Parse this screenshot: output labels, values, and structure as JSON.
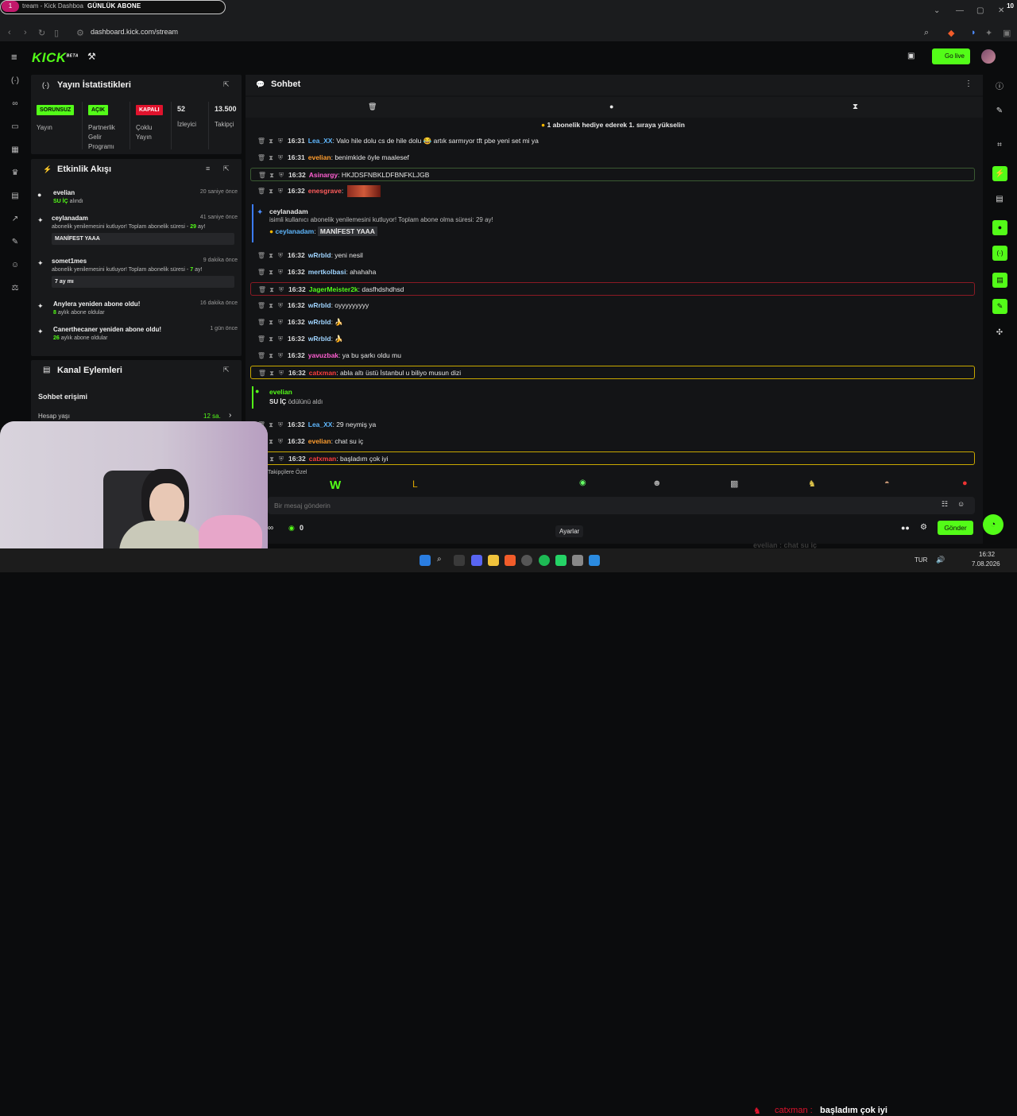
{
  "browser": {
    "tab_counter": "1",
    "tab_title": "tream - Kick Dashboa",
    "overlay_text": "GÜNLÜK ABONE",
    "overlay_count": "10",
    "url": "dashboard.kick.com/stream"
  },
  "header": {
    "logo": "KICK",
    "logo_tag": "BETA",
    "go_live": "Go live"
  },
  "stats_panel": {
    "title": "Yayın İstatistikleri",
    "items": [
      {
        "badge": "SORUNSUZ",
        "badge_color": "#53fc18",
        "label": "Yayın"
      },
      {
        "badge": "AÇIK",
        "badge_color": "#53fc18",
        "label": "Partnerlik Gelir Programı"
      },
      {
        "badge": "KAPALI",
        "badge_color": "#e0132d",
        "label": "Çoklu Yayın"
      },
      {
        "value": "52",
        "label": "İzleyici"
      },
      {
        "value": "13.500",
        "label": "Takipçi"
      }
    ]
  },
  "activity_panel": {
    "title": "Etkinlik Akışı",
    "items": [
      {
        "name": "evelian",
        "time": "20 saniye önce",
        "sub_highlight": "SU İÇ",
        "sub": "alındı"
      },
      {
        "name": "ceylanadam",
        "time": "41 saniye önce",
        "sub": "abonelik yenilemesini kutluyor! Toplam abonelik süresi -",
        "months": "29",
        "sub_end": "ay!",
        "box": "MANİFEST YAAA"
      },
      {
        "name": "somet1mes",
        "time": "9 dakika önce",
        "sub": "abonelik yenilemesini kutluyor! Toplam abonelik süresi -",
        "months": "7",
        "sub_end": "ay!",
        "box": "7 ay mı"
      },
      {
        "name": "Anylera yeniden abone oldu!",
        "time": "16 dakika önce",
        "count": "8",
        "sub": "aylık abone oldular"
      },
      {
        "name": "Canerthecaner yeniden abone oldu!",
        "time": "1 gün önce",
        "count": "26",
        "sub": "aylık abone oldular"
      }
    ]
  },
  "channel_panel": {
    "title": "Kanal Eylemleri",
    "section": "Sohbet erişimi",
    "row_label": "Hesap yaşı",
    "row_value": "12 sa."
  },
  "chat": {
    "title": "Sohbet",
    "pinned": "1 abonelik hediye ederek 1. sıraya yükselin",
    "messages": [
      {
        "time": "16:31",
        "user": "Lea_XX",
        "color": "#5fb8ff",
        "text": "Valo hile dolu cs de hile dolu 😂 artık sarmıyor tft pbe yeni set mi ya"
      },
      {
        "time": "16:31",
        "user": "evelian",
        "color": "#ff9d2e",
        "text": "benimkide öyle maalesef"
      },
      {
        "time": "16:32",
        "user": "Asinargy",
        "color": "#ff5fd2",
        "text": "HKJDSFNBKLDFBNFKLJGB",
        "hl": "#3a5a32"
      },
      {
        "time": "16:32",
        "user": "enesgrave",
        "color": "#ff5c5c",
        "text": ""
      },
      {
        "time": "16:32",
        "user": "wRrbld",
        "color": "#9fd4ff",
        "text": "yeni nesil"
      },
      {
        "time": "16:32",
        "user": "mertkolbasi",
        "color": "#9fd4ff",
        "text": "ahahaha"
      },
      {
        "time": "16:32",
        "user": "JagerMeister2k",
        "color": "#53fc18",
        "text": "dasfhdshdhsd",
        "hl": "#8b1a24"
      },
      {
        "time": "16:32",
        "user": "wRrbld",
        "color": "#9fd4ff",
        "text": "oyyyyyyyyy"
      },
      {
        "time": "16:32",
        "user": "wRrbld",
        "color": "#9fd4ff",
        "text": "🍌"
      },
      {
        "time": "16:32",
        "user": "wRrbld",
        "color": "#9fd4ff",
        "text": "🍌"
      },
      {
        "time": "16:32",
        "user": "yavuzbak",
        "color": "#ff5fd2",
        "text": "ya bu şarkı oldu mu"
      },
      {
        "time": "16:32",
        "user": "catxman",
        "color": "#ff3d3d",
        "text": "abla altı üstü İstanbul u biliyo musun dizi",
        "hl": "#c9a800"
      },
      {
        "time": "16:32",
        "user": "Lea_XX",
        "color": "#5fb8ff",
        "text": "29 neymiş ya"
      },
      {
        "time": "16:32",
        "user": "evelian",
        "color": "#ff9d2e",
        "text": "chat su iç"
      },
      {
        "time": "16:32",
        "user": "catxman",
        "color": "#ff3d3d",
        "text": "başladım çok iyi",
        "hl": "#c9a800"
      }
    ],
    "resub": {
      "user": "ceylanadam",
      "line": "isimli kullanıcı abonelik yenilemesini kutluyor! Toplam abone olma süresi: 29 ay!",
      "msg_user": "ceylanadam",
      "msg": "MANİFEST YAAA"
    },
    "reward": {
      "user": "evelian",
      "reward": "SU İÇ",
      "text": "ödülünü aldı"
    },
    "emote_bar_label": "Takipçilere Özel",
    "input_placeholder": "Bir mesaj gönderin",
    "points": "0",
    "send": "Gönder",
    "tooltip": "Ayarlar"
  },
  "overlay": {
    "ghost_msg": "evelian : chat su iç",
    "ticker_user": "catxman :",
    "ticker_text": "başladım çok iyi"
  },
  "taskbar": {
    "lang": "TUR",
    "time": "16:32",
    "date": "7.08.2026"
  }
}
